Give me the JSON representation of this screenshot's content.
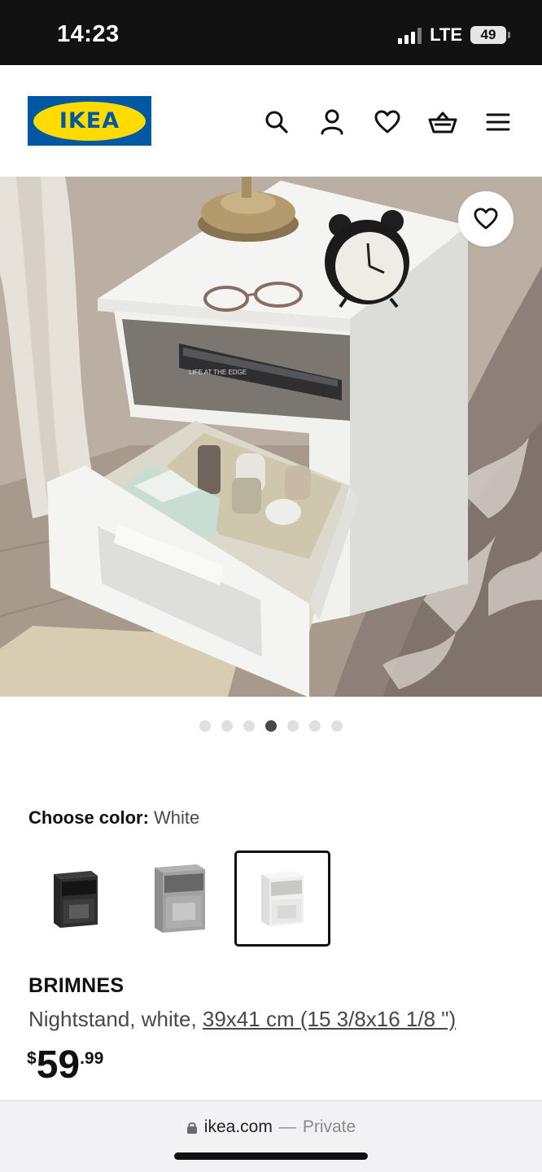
{
  "status_bar": {
    "time": "14:23",
    "network": "LTE",
    "battery": "49"
  },
  "header": {
    "logo_text": "IKEA",
    "icons": [
      "search-icon",
      "account-icon",
      "heart-icon",
      "basket-icon",
      "menu-icon"
    ]
  },
  "gallery": {
    "image_count": 7,
    "active_index": 3,
    "book_spine_text": "LIFE AT THE EDGE"
  },
  "color_chooser": {
    "label": "Choose color:",
    "selected_value": "White",
    "options": [
      "black-brown",
      "grey",
      "white"
    ],
    "selected_index": 2
  },
  "product": {
    "name": "BRIMNES",
    "description": "Nightstand, white, ",
    "dimensions": "39x41 cm (15 3/8x16 1/8 \")",
    "price_currency": "$",
    "price_integer": "59",
    "price_decimal": ".99"
  },
  "browser": {
    "domain": "ikea.com",
    "separator": "—",
    "mode": "Private"
  },
  "colors": {
    "brand_blue": "#0058a3",
    "brand_yellow": "#ffdb00",
    "status_bar": "#121212"
  }
}
